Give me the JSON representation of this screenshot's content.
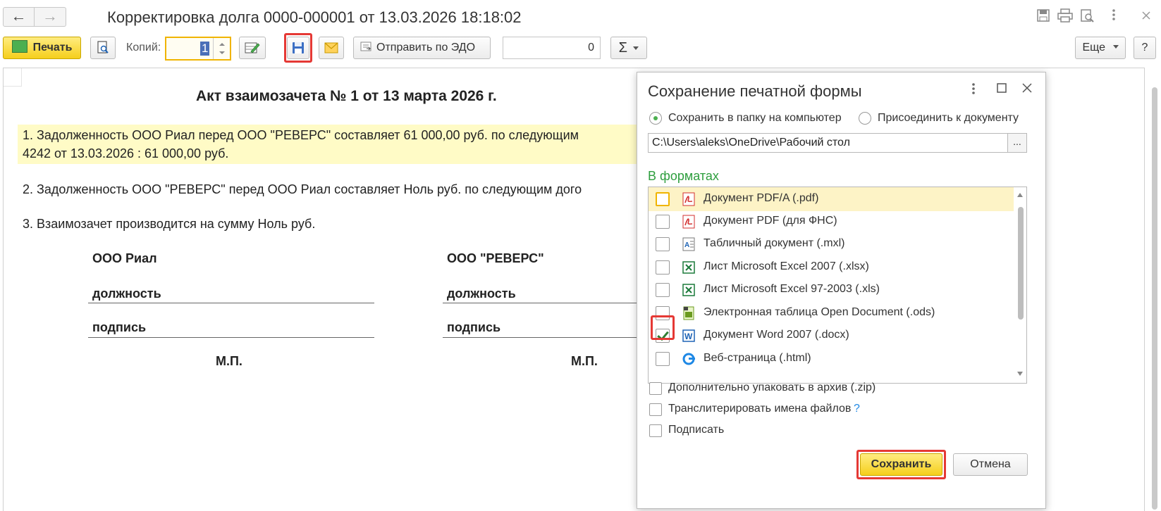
{
  "window": {
    "title": "Корректировка долга 0000-000001 от 13.03.2026 18:18:02",
    "back_glyph": "←",
    "forward_glyph": "→"
  },
  "toolbar": {
    "print_label": "Печать",
    "copies_label": "Копий:",
    "copies_value": "1",
    "send_edo_label": "Отправить по ЭДО",
    "counter_value": "0",
    "sum_glyph": "Σ",
    "more_label": "Еще",
    "help_label": "?"
  },
  "document": {
    "heading": "Акт взаимозачета № 1 от 13 марта 2026 г.",
    "line1a": "1. Задолженность ООО Риал перед ООО \"РЕВЕРС\" составляет 61 000,00 руб. по следующим",
    "line1b": "4242 от 13.03.2026 :     61 000,00 руб.",
    "line2": "2. Задолженность ООО \"РЕВЕРС\" перед ООО Риал составляет Ноль руб. по следующим дого",
    "line3": "3. Взаимозачет производится на сумму Ноль руб.",
    "party_left": "ООО Риал",
    "party_right": "ООО \"РЕВЕРС\"",
    "position_label": "должность",
    "signature_label": "подпись",
    "stamp_label": "М.П."
  },
  "dialog": {
    "title": "Сохранение печатной формы",
    "radio_save_folder": "Сохранить в папку на компьютер",
    "radio_attach": "Присоединить к документу",
    "path": "C:\\Users\\aleks\\OneDrive\\Рабочий стол",
    "path_button": "...",
    "formats_title": "В форматах",
    "formats": [
      {
        "name": "Документ PDF/A (.pdf)",
        "icon": "pdf-icon",
        "checked": false
      },
      {
        "name": "Документ PDF (для ФНС)",
        "icon": "pdf-icon",
        "checked": false
      },
      {
        "name": "Табличный документ (.mxl)",
        "icon": "mxl-icon",
        "checked": false
      },
      {
        "name": "Лист Microsoft Excel 2007 (.xlsx)",
        "icon": "excel-icon",
        "checked": false
      },
      {
        "name": "Лист Microsoft Excel 97-2003 (.xls)",
        "icon": "excel-icon",
        "checked": false
      },
      {
        "name": "Электронная таблица Open Document (.ods)",
        "icon": "ods-icon",
        "checked": false
      },
      {
        "name": "Документ Word 2007 (.docx)",
        "icon": "word-icon",
        "checked": true
      },
      {
        "name": "Веб-страница (.html)",
        "icon": "html-icon",
        "checked": false
      }
    ],
    "opt_zip": "Дополнительно упаковать в архив (.zip)",
    "opt_translit": "Транслитерировать имена файлов",
    "opt_translit_help": "?",
    "opt_sign": "Подписать",
    "save_label": "Сохранить",
    "cancel_label": "Отмена"
  },
  "colors": {
    "accent_yellow": "#f5cf1c",
    "highlight_red": "#e53935",
    "formats_green": "#2e9e3e"
  }
}
